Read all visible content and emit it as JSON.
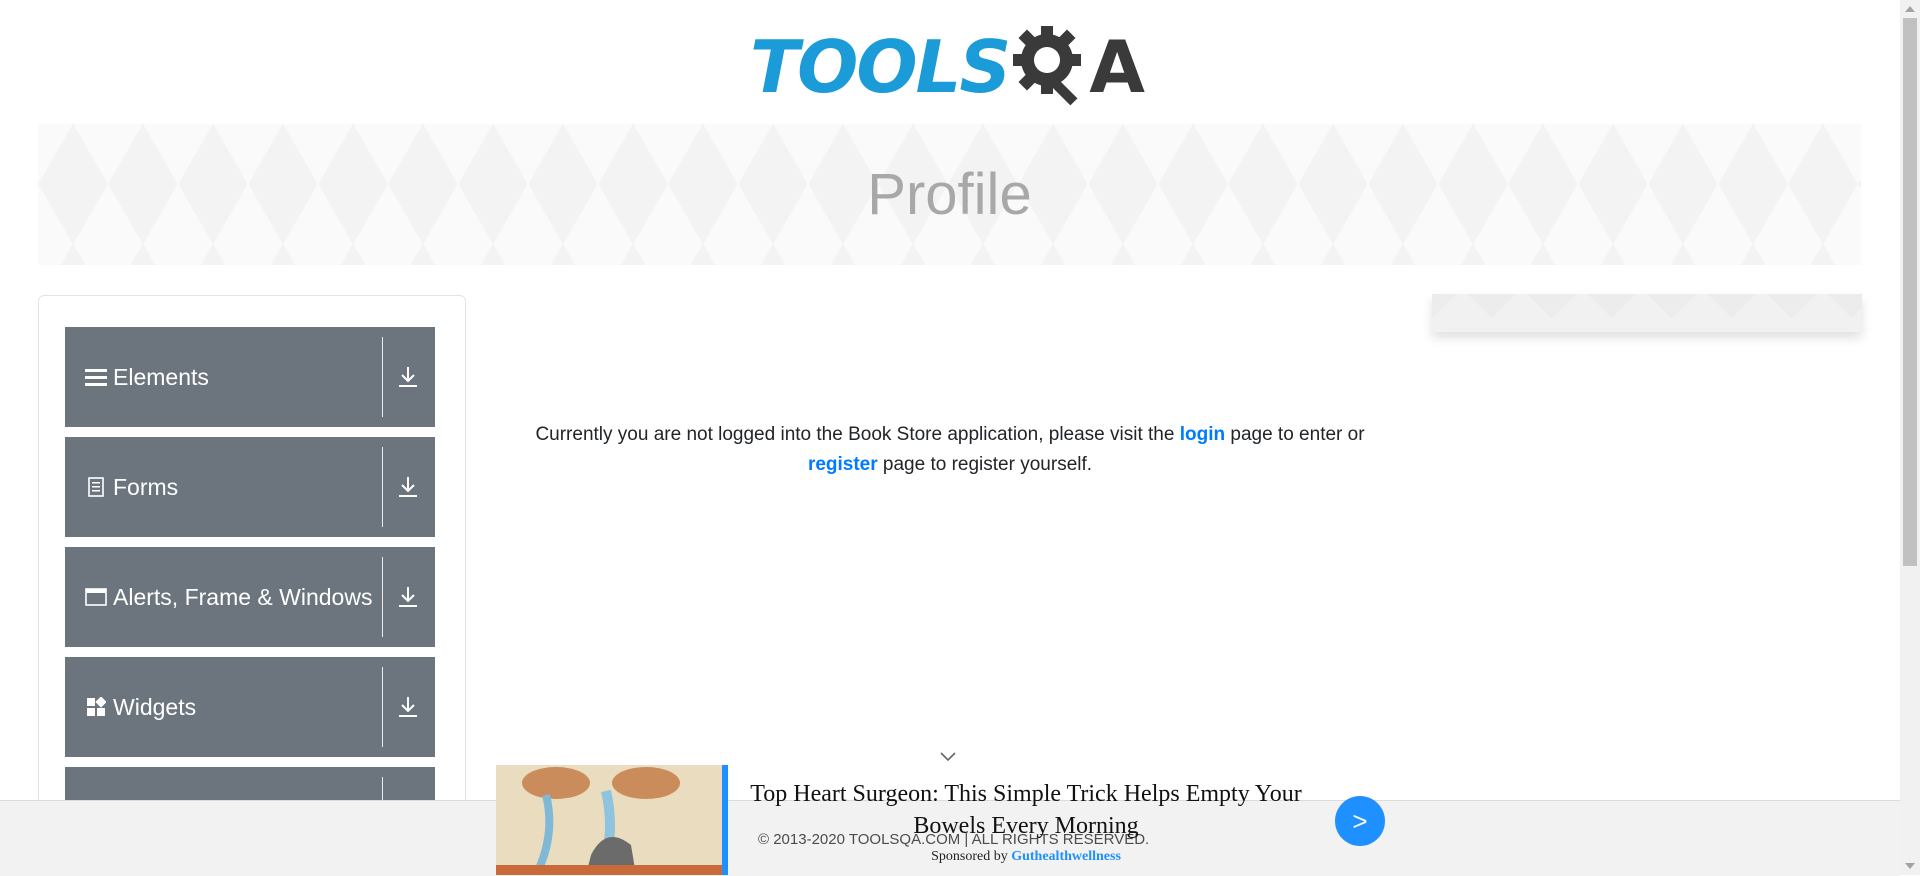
{
  "header": {
    "logo_part1": "TOOLS",
    "logo_part2": "A",
    "logo_icon": "gear-magnifier-icon",
    "colors": {
      "brand_blue": "#1b9bd7",
      "brand_dark": "#3a3a3a"
    }
  },
  "banner": {
    "title": "Profile"
  },
  "sidebar": {
    "groups": [
      {
        "label": "Elements",
        "icon": "list-icon"
      },
      {
        "label": "Forms",
        "icon": "document-icon"
      },
      {
        "label": "Alerts, Frame & Windows",
        "icon": "window-icon"
      },
      {
        "label": "Widgets",
        "icon": "widgets-icon"
      }
    ],
    "color": "#6c757d"
  },
  "message": {
    "part1": "Currently you are not logged into the Book Store application, please visit the",
    "login_link": "login",
    "part2": "page to enter or",
    "register_link": "register",
    "part3": "page to register yourself.",
    "link_color": "#007bff"
  },
  "footer": {
    "copyright": "© 2013-2020 TOOLSQA.COM | ALL RIGHTS RESERVED."
  },
  "ad": {
    "headline": "Top Heart Surgeon: This Simple Trick Helps Empty Your Bowels Every Morning",
    "sponsored_by": "Sponsored by",
    "sponsor": "Guthealthwellness",
    "go_label": ">",
    "accent": "#1e90ff"
  }
}
